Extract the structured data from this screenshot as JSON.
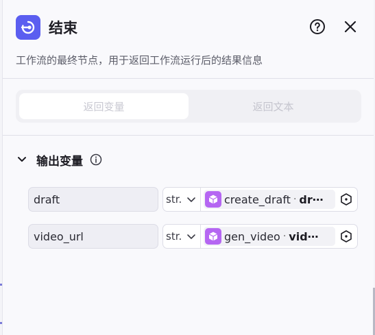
{
  "header": {
    "title": "结束",
    "description": "工作流的最终节点，用于返回工作流运行后的结果信息"
  },
  "tabs": [
    {
      "label": "返回变量",
      "active": true
    },
    {
      "label": "返回文本",
      "active": false
    }
  ],
  "section": {
    "title": "输出变量"
  },
  "outputs": [
    {
      "name": "draft",
      "type": "str.",
      "ref_node": "create_draft",
      "ref_sep": "·",
      "ref_field": "dr⋯"
    },
    {
      "name": "video_url",
      "type": "str.",
      "ref_node": "gen_video",
      "ref_sep": "·",
      "ref_field": "vid⋯"
    }
  ],
  "colors": {
    "node_icon": "#5b5ef0",
    "ref_cube": "#b566f2"
  }
}
